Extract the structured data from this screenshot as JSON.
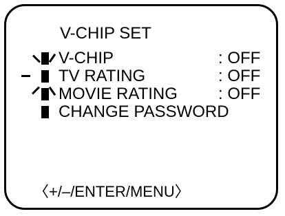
{
  "menu": {
    "title": "V-CHIP SET",
    "items": [
      {
        "label": "V-CHIP",
        "value": ": OFF"
      },
      {
        "label": "TV RATING",
        "value": ": OFF"
      },
      {
        "label": "MOVIE RATING",
        "value": ": OFF"
      },
      {
        "label": "CHANGE PASSWORD",
        "value": ""
      }
    ],
    "selected_index": 1,
    "footer": "〈+/–/ENTER/MENU〉"
  }
}
